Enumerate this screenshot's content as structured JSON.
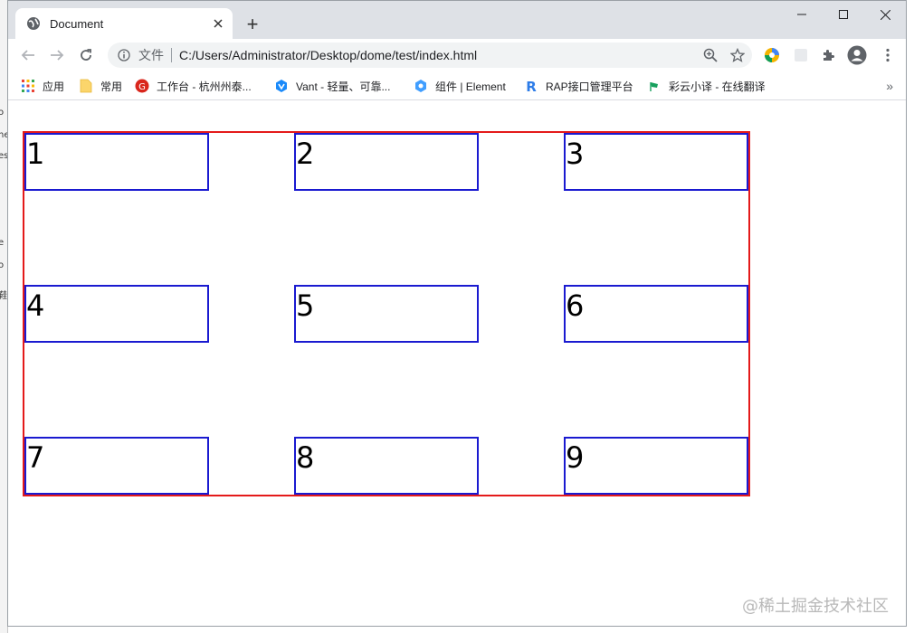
{
  "window": {
    "tab_title": "Document",
    "new_tab_label": "+"
  },
  "toolbar": {
    "scheme_label": "文件",
    "url": "C:/Users/Administrator/Desktop/dome/test/index.html"
  },
  "bookmarks": [
    {
      "label": "应用",
      "icon": "apps-grid-icon"
    },
    {
      "label": "常用",
      "icon": "folder-icon"
    },
    {
      "label": "工作台 - 杭州州泰...",
      "icon": "workbench-logo-icon"
    },
    {
      "label": "Vant - 轻量、可靠...",
      "icon": "vant-logo-icon"
    },
    {
      "label": "组件 | Element",
      "icon": "element-logo-icon"
    },
    {
      "label": "RAP接口管理平台",
      "icon": "rap-logo-icon"
    },
    {
      "label": "彩云小译 - 在线翻译",
      "icon": "caiyun-logo-icon"
    }
  ],
  "bookmarks_more": "»",
  "page": {
    "cells": [
      "1",
      "2",
      "3",
      "4",
      "5",
      "6",
      "7",
      "8",
      "9"
    ]
  },
  "background_window_fragments": [
    "o",
    "ne",
    "es",
    "e",
    "o",
    "鞋"
  ],
  "watermark": "@稀土掘金技术社区",
  "colors": {
    "container_border": "#e41a1a",
    "cell_border": "#1a1ad0",
    "tabbar_bg": "#dee1e6"
  }
}
